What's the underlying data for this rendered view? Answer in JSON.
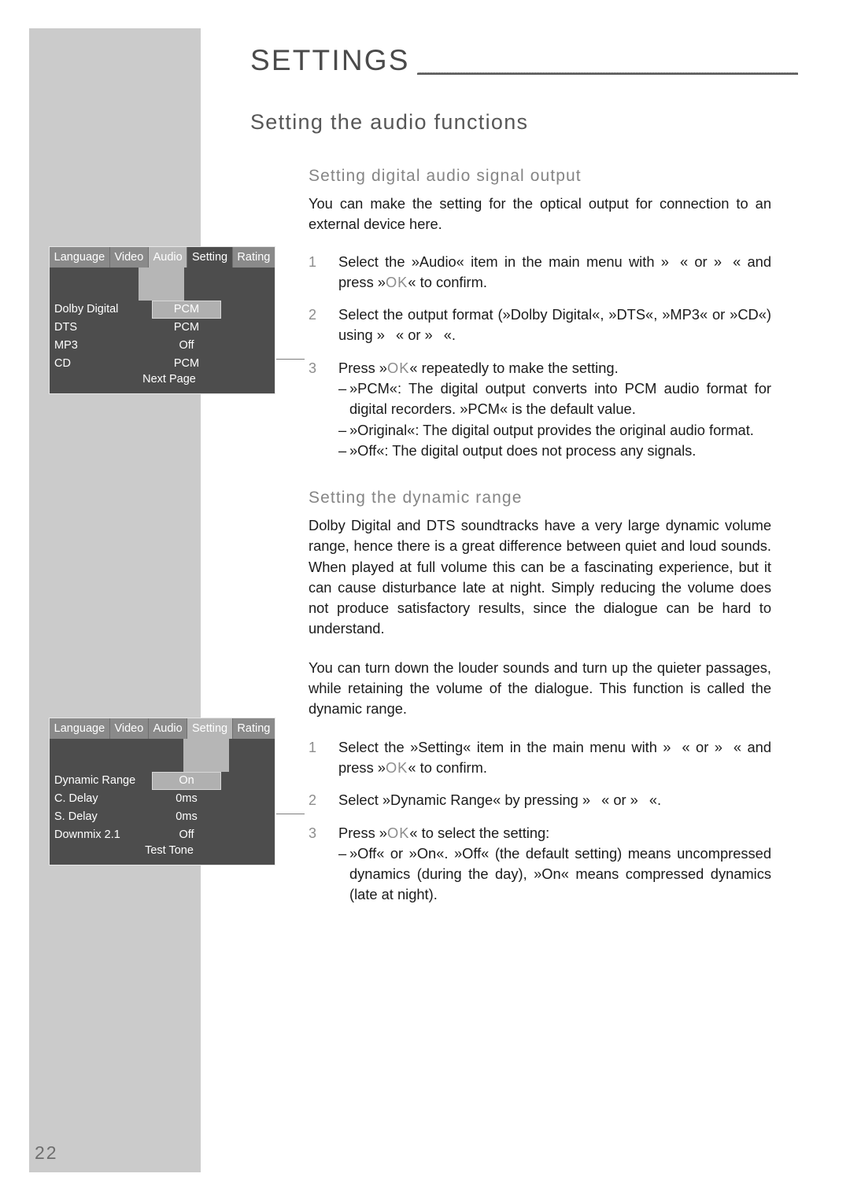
{
  "page": {
    "number": "22",
    "chapter_title": "SETTINGS"
  },
  "headings": {
    "section": "Setting the audio functions",
    "sub_digital": "Setting digital audio signal output",
    "sub_dynamic": "Setting the dynamic range"
  },
  "digital_audio": {
    "intro": "You can make the setting for the optical output for connection to an external device here.",
    "step1_num": "1",
    "step1_a": "Select the »Audio« item in the main menu with »",
    "step1_b": "« or »",
    "step1_c": "« and press »",
    "step1_ok": "OK",
    "step1_d": "« to confirm.",
    "step2_num": "2",
    "step2_a": "Select the output format (»Dolby Digital«, »DTS«, »MP3« or »CD«) using »",
    "step2_b": "« or »",
    "step2_c": "«.",
    "step3_num": "3",
    "step3_a": "Press »",
    "step3_ok": "OK",
    "step3_b": "« repeatedly to make the setting.",
    "bullet_dash": "–",
    "bullet_pcm": "»PCM«: The digital output converts into PCM audio format for digital recorders. »PCM« is the default value.",
    "bullet_original": "»Original«: The digital output provides the original audio format.",
    "bullet_off": "»Off«: The digital output does not process any signals."
  },
  "dynamic_range": {
    "para1": "Dolby Digital and DTS soundtracks have a very large dynamic volume range, hence there is a great difference between quiet and loud sounds. When played at full volume this can be a fascinating experience, but it can cause disturbance late at night. Simply reducing the volume does not produce satisfactory results, since the dialogue can be hard to understand.",
    "para2": "You can turn down the louder sounds and turn up the quieter passages, while retaining the volume of the dialogue. This function is called the dynamic range.",
    "step1_num": "1",
    "step1_a": "Select the »Setting« item in the main menu with »",
    "step1_b": "« or »",
    "step1_c": "« and press »",
    "step1_ok": "OK",
    "step1_d": "« to confirm.",
    "step2_num": "2",
    "step2_a": "Select »Dynamic Range« by pressing »",
    "step2_b": "« or »",
    "step2_c": "«.",
    "step3_num": "3",
    "step3_a": "Press »",
    "step3_ok": "OK",
    "step3_b": "« to select the setting:",
    "bullet_dash": "–",
    "bullet_onoff": "»Off« or »On«. »Off« (the default setting) means uncompressed dynamics (during the day), »On« means compressed dynamics (late at night)."
  },
  "osd_audio": {
    "tabs": [
      {
        "label": "Language",
        "state": "normal"
      },
      {
        "label": "Video",
        "state": "normal"
      },
      {
        "label": "Audio",
        "state": "active"
      },
      {
        "label": "Setting",
        "state": "dim"
      },
      {
        "label": "Rating",
        "state": "normal"
      }
    ],
    "rows": [
      {
        "label": "Dolby Digital",
        "value": "PCM",
        "selected": true
      },
      {
        "label": "DTS",
        "value": "PCM",
        "selected": false
      },
      {
        "label": "MP3",
        "value": "Off",
        "selected": false
      },
      {
        "label": "CD",
        "value": "PCM",
        "selected": false
      }
    ],
    "footer": "Next Page"
  },
  "osd_setting": {
    "tabs": [
      {
        "label": "Language",
        "state": "normal"
      },
      {
        "label": "Video",
        "state": "normal"
      },
      {
        "label": "Audio",
        "state": "normal"
      },
      {
        "label": "Setting",
        "state": "active"
      },
      {
        "label": "Rating",
        "state": "normal"
      }
    ],
    "rows": [
      {
        "label": "Dynamic Range",
        "value": "On",
        "selected": true
      },
      {
        "label": "C. Delay",
        "value": "0ms",
        "selected": false
      },
      {
        "label": "S. Delay",
        "value": "0ms",
        "selected": false
      },
      {
        "label": "Downmix 2.1",
        "value": "Off",
        "selected": false
      }
    ],
    "footer": "Test Tone"
  },
  "colors": {
    "side_band": "#cbcbcb",
    "osd_background": "#4d4d4d",
    "osd_tab": "#8a8a8a",
    "osd_active": "#b6b6b6",
    "heading": "#575757",
    "subheading": "#858585"
  }
}
